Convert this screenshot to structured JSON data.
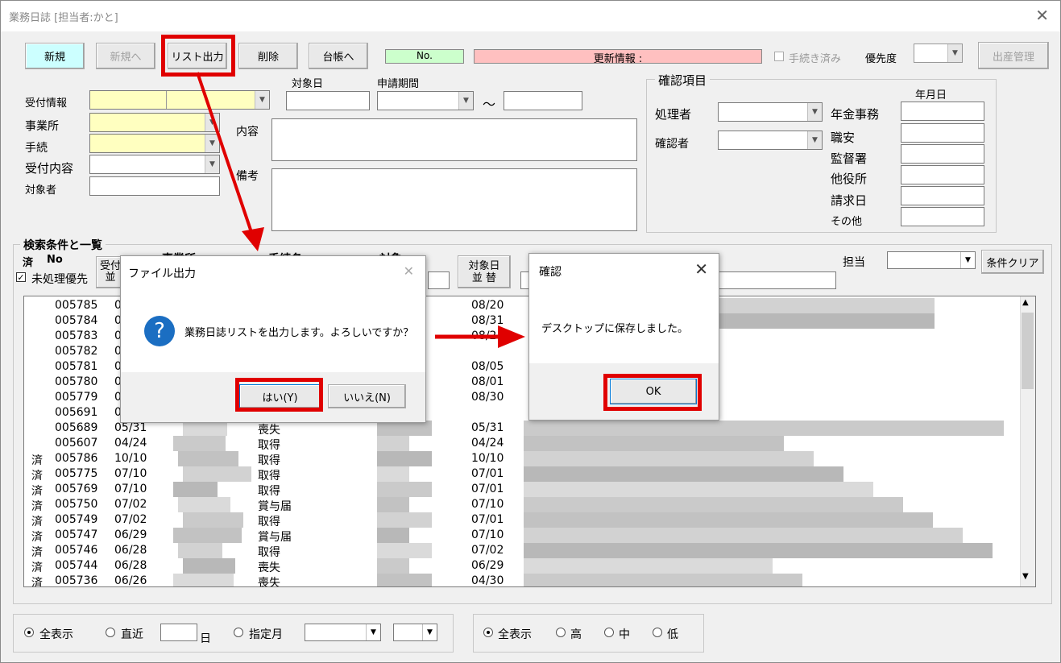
{
  "window": {
    "title": "業務日誌 [担当者:かと]",
    "close": "✕"
  },
  "toolbar": {
    "new": "新規",
    "new_to": "新規へ",
    "list_output": "リスト出力",
    "delete": "削除",
    "ledger": "台帳へ",
    "no_label": "No.",
    "update_info": "更新情報 :",
    "procedure_done": "手続き済み",
    "priority": "優先度",
    "birth_mgmt": "出産管理"
  },
  "form": {
    "reception_info": "受付情報",
    "office": "事業所",
    "procedure": "手続",
    "reception_content": "受付内容",
    "target_person": "対象者",
    "target_date": "対象日",
    "application_period": "申請期間",
    "tilde": "〜",
    "content": "内容",
    "remarks": "備考"
  },
  "confirm_group": {
    "title": "確認項目",
    "date_header": "年月日",
    "processor": "処理者",
    "confirmer": "確認者",
    "items": [
      "年金事務",
      "職安",
      "監督署",
      "他役所",
      "請求日",
      "その他"
    ]
  },
  "search": {
    "title": "検索条件と一覧",
    "col_done": "済",
    "col_no": "No",
    "reception_sort": "受付\n並",
    "target_date_sort": "対象日\n並 替",
    "unprocessed_first": "未処理優先",
    "assignee": "担当",
    "clear": "条件クリア",
    "hidden_hdr1": "事業所",
    "hidden_hdr2": "手続名",
    "hidden_hdr3": "対象"
  },
  "rows": [
    {
      "done": "",
      "no": "005785",
      "date": "0",
      "proc": "",
      "tdate": "08/20"
    },
    {
      "done": "",
      "no": "005784",
      "date": "0",
      "proc": "",
      "tdate": "08/31"
    },
    {
      "done": "",
      "no": "005783",
      "date": "0",
      "proc": "",
      "tdate": "08/2"
    },
    {
      "done": "",
      "no": "005782",
      "date": "0",
      "proc": "",
      "tdate": ""
    },
    {
      "done": "",
      "no": "005781",
      "date": "0",
      "proc": "",
      "tdate": "08/05"
    },
    {
      "done": "",
      "no": "005780",
      "date": "0",
      "proc": "",
      "tdate": "08/01"
    },
    {
      "done": "",
      "no": "005779",
      "date": "0",
      "proc": "",
      "tdate": "08/30"
    },
    {
      "done": "",
      "no": "005691",
      "date": "0",
      "proc": "",
      "tdate": ""
    },
    {
      "done": "",
      "no": "005689",
      "date": "05/31",
      "proc": "喪失",
      "tdate": "05/31"
    },
    {
      "done": "",
      "no": "005607",
      "date": "04/24",
      "proc": "取得",
      "tdate": "04/24"
    },
    {
      "done": "済",
      "no": "005786",
      "date": "10/10",
      "proc": "取得",
      "tdate": "10/10"
    },
    {
      "done": "済",
      "no": "005775",
      "date": "07/10",
      "proc": "取得",
      "tdate": "07/01"
    },
    {
      "done": "済",
      "no": "005769",
      "date": "07/10",
      "proc": "取得",
      "tdate": "07/01"
    },
    {
      "done": "済",
      "no": "005750",
      "date": "07/02",
      "proc": "賞与届",
      "tdate": "07/10"
    },
    {
      "done": "済",
      "no": "005749",
      "date": "07/02",
      "proc": "取得",
      "tdate": "07/01"
    },
    {
      "done": "済",
      "no": "005747",
      "date": "06/29",
      "proc": "賞与届",
      "tdate": "07/10"
    },
    {
      "done": "済",
      "no": "005746",
      "date": "06/28",
      "proc": "取得",
      "tdate": "07/02"
    },
    {
      "done": "済",
      "no": "005744",
      "date": "06/28",
      "proc": "喪失",
      "tdate": "06/29"
    },
    {
      "done": "済",
      "no": "005736",
      "date": "06/26",
      "proc": "喪失",
      "tdate": "04/30"
    }
  ],
  "bottom_left": {
    "all": "全表示",
    "recent": "直近",
    "day": "日",
    "month": "指定月"
  },
  "bottom_right": {
    "all": "全表示",
    "high": "高",
    "mid": "中",
    "low": "低"
  },
  "dialog_file": {
    "title": "ファイル出力",
    "message": "業務日誌リストを出力します。よろしいですか？",
    "yes": "はい(Y)",
    "no": "いいえ(N)"
  },
  "dialog_confirm": {
    "title": "確認",
    "message": "デスクトップに保存しました。",
    "ok": "OK"
  },
  "colors": {
    "new_btn": "#ccffff",
    "no_field": "#ccffcc",
    "update_field": "#ffc0c0",
    "highlight": "#e00000",
    "yellow_field": "#ffffc0"
  }
}
